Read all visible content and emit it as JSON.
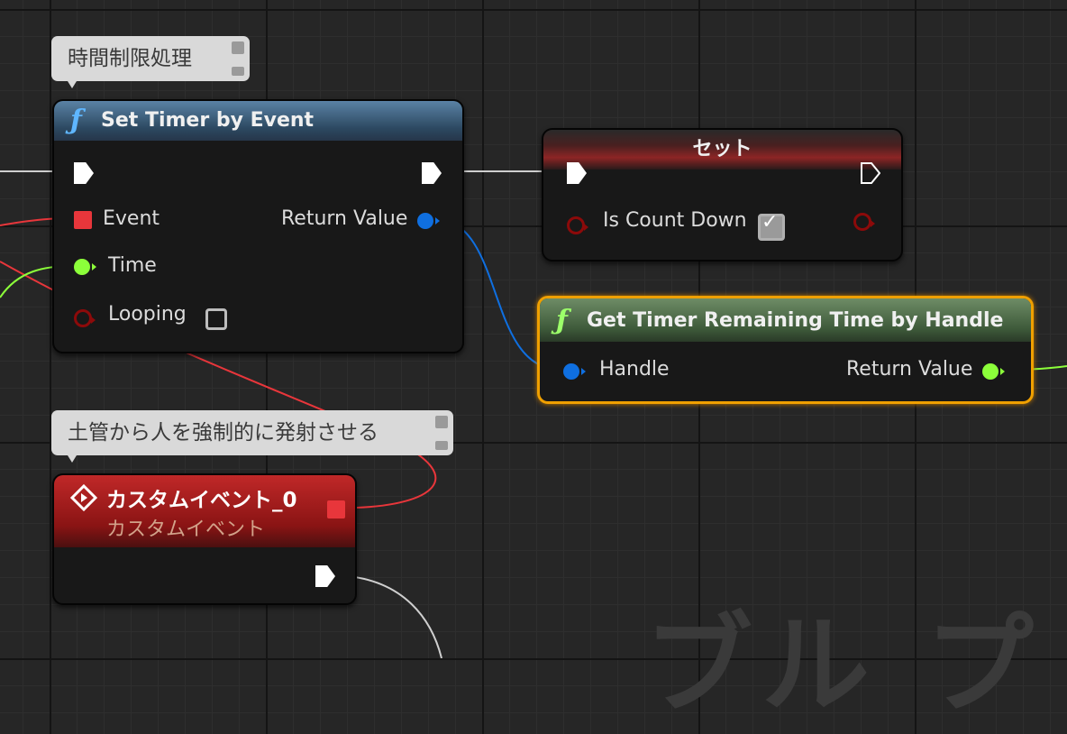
{
  "comments": {
    "timer_comment": "時間制限処理",
    "event_comment": "土管から人を強制的に発射させる"
  },
  "set_timer_node": {
    "title": "Set Timer by Event",
    "function_icon": "ƒ",
    "pins": {
      "event": "Event",
      "time": "Time",
      "looping": "Looping",
      "return_value": "Return Value"
    },
    "looping_checked": false,
    "header_color": "#3f6684"
  },
  "set_node": {
    "title": "セット",
    "pins": {
      "is_count_down": "Is Count Down"
    },
    "is_count_down_checked": true,
    "header_color": "#7a1f1f"
  },
  "get_timer_node": {
    "title": "Get Timer Remaining Time by Handle",
    "function_icon": "ƒ",
    "pins": {
      "handle": "Handle",
      "return_value": "Return Value"
    },
    "selected": true,
    "header_color": "#4f6a4a",
    "selection_color": "#f0a000"
  },
  "custom_event_node": {
    "title": "カスタムイベント_0",
    "subtitle": "カスタムイベント",
    "header_color": "#b31b1b"
  },
  "watermark": "ブル プ",
  "pin_colors": {
    "exec": "#ffffff",
    "delegate": "#e8363b",
    "float": "#8cff3a",
    "struct_handle": "#0f6fe0",
    "boolean": "#8c0a0a"
  }
}
